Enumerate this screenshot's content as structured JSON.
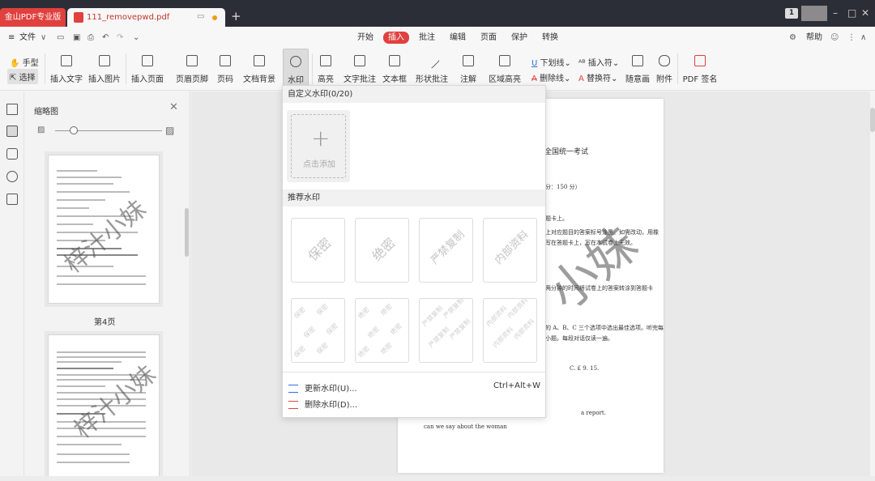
{
  "titlebar": {
    "brand_tab": "金山PDF专业版",
    "doc_tab": "111_removepwd.pdf",
    "window_badge": "1"
  },
  "menubar": {
    "file_label": "文件",
    "tabs": [
      "开始",
      "插入",
      "批注",
      "编辑",
      "页面",
      "保护",
      "转换"
    ],
    "active_tab": "插入",
    "help_label": "帮助"
  },
  "ribbon": {
    "hand_tool": "手型",
    "select_tool": "选择",
    "buttons": [
      "插入文字",
      "插入图片",
      "插入页面",
      "页眉页脚",
      "页码",
      "文档背景",
      "水印",
      "高亮",
      "文字批注",
      "文本框",
      "形状批注",
      "注解",
      "区域高亮"
    ],
    "small_buttons": [
      "下划线",
      "插入符",
      "删除线",
      "替换符"
    ],
    "tail_buttons": [
      "随意画",
      "附件",
      "PDF 签名"
    ]
  },
  "thumbnails": {
    "title": "缩略图",
    "page_label": "第4页",
    "watermark_text": "梓汁小妹"
  },
  "document": {
    "lines": [
      "三全国统一考试",
      "分：150 分）",
      "题卡上。",
      "上对应题目的答案标号涂黑。如需改动，用橡",
      "写在答题卡上，写在本试卷上无效。",
      "两分钟的时间将试卷上的答案转涂到答题卡",
      "的 A、B、C 三个选项中选出最佳选项。听完每",
      "小题。每段对话仅读一遍。",
      "C. £ 9. 15.",
      "a report.",
      "can we say about the woman"
    ],
    "watermark_text": "小妹"
  },
  "dropdown": {
    "custom_header": "自定义水印(0/20)",
    "add_label": "点击添加",
    "recommended_header": "推荐水印",
    "presets": [
      "保密",
      "绝密",
      "严禁复制",
      "内部资料"
    ],
    "update_label": "更新水印(U)...",
    "update_shortcut": "Ctrl+Alt+W",
    "delete_label": "删除水印(D)..."
  }
}
